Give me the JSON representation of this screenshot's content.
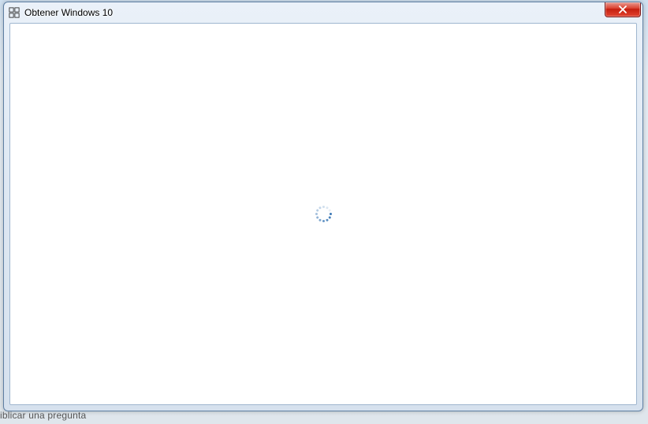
{
  "window": {
    "title": "Obtener Windows 10"
  },
  "background": {
    "partial_text": "iblicar una pregunta"
  },
  "colors": {
    "close_button": "#d93b2a",
    "spinner_dot": "#3b78b5",
    "titlebar_gradient_top": "#eaf1f9",
    "titlebar_gradient_bottom": "#d6e1ee"
  }
}
